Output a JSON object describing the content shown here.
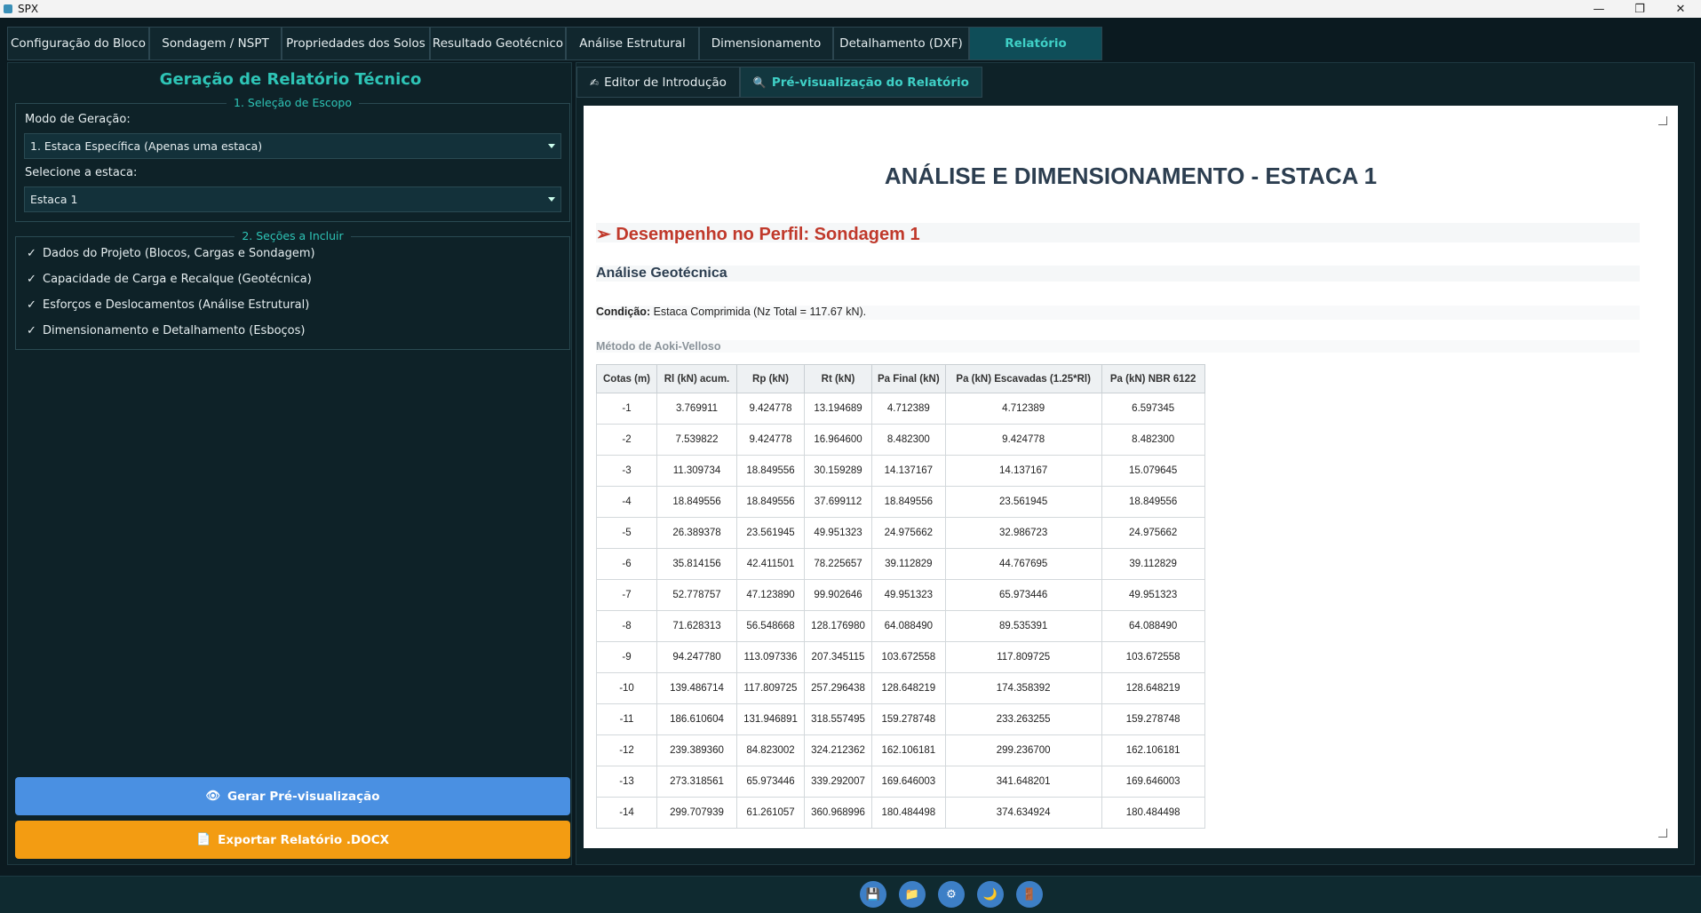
{
  "window": {
    "title": "SPX",
    "min": "—",
    "max": "❐",
    "close": "✕"
  },
  "tabs": [
    {
      "label": "Configuração do Bloco"
    },
    {
      "label": "Sondagem / NSPT"
    },
    {
      "label": "Propriedades dos Solos"
    },
    {
      "label": "Resultado Geotécnico"
    },
    {
      "label": "Análise Estrutural"
    },
    {
      "label": "Dimensionamento"
    },
    {
      "label": "Detalhamento (DXF)"
    },
    {
      "label": "Relatório"
    }
  ],
  "left": {
    "title": "Geração de Relatório Técnico",
    "scope": {
      "legend": "1. Seleção de Escopo",
      "mode_label": "Modo de Geração:",
      "mode_value": "1. Estaca Específica (Apenas uma estaca)",
      "pile_label": "Selecione a estaca:",
      "pile_value": "Estaca 1"
    },
    "sections": {
      "legend": "2. Seções a Incluir",
      "items": [
        {
          "mark": "✓",
          "label": "Dados do Projeto (Blocos, Cargas e Sondagem)"
        },
        {
          "mark": "✓",
          "label": "Capacidade de Carga e Recalque (Geotécnica)"
        },
        {
          "mark": "✓",
          "label": "Esforços e Deslocamentos (Análise Estrutural)"
        },
        {
          "mark": "✓",
          "label": "Dimensionamento e Detalhamento (Esboços)"
        }
      ]
    },
    "preview_button": "Gerar Pré-visualização",
    "export_button": "Exportar Relatório .DOCX",
    "colors": {
      "preview_button": "#4a90e2",
      "export_button": "#f39c12"
    }
  },
  "right": {
    "subtabs": [
      {
        "icon": "✍",
        "label": "Editor de Introdução"
      },
      {
        "icon": "🔍",
        "label": "Pré-visualização do Relatório"
      }
    ],
    "doc": {
      "h1": "ANÁLISE E DIMENSIONAMENTO - ESTACA 1",
      "h2": "➢ Desempenho no Perfil: Sondagem 1",
      "h3": "Análise Geotécnica",
      "cond_label": "Condição:",
      "cond_text": " Estaca Comprimida (Nz Total = 117.67 kN).",
      "h4": "Método de Aoki-Velloso",
      "table": {
        "headers": [
          "Cotas (m)",
          "Rl (kN) acum.",
          "Rp (kN)",
          "Rt (kN)",
          "Pa Final (kN)",
          "Pa (kN) Escavadas (1.25*Rl)",
          "Pa (kN) NBR 6122"
        ],
        "rows": [
          [
            "-1",
            "3.769911",
            "9.424778",
            "13.194689",
            "4.712389",
            "4.712389",
            "6.597345"
          ],
          [
            "-2",
            "7.539822",
            "9.424778",
            "16.964600",
            "8.482300",
            "9.424778",
            "8.482300"
          ],
          [
            "-3",
            "11.309734",
            "18.849556",
            "30.159289",
            "14.137167",
            "14.137167",
            "15.079645"
          ],
          [
            "-4",
            "18.849556",
            "18.849556",
            "37.699112",
            "18.849556",
            "23.561945",
            "18.849556"
          ],
          [
            "-5",
            "26.389378",
            "23.561945",
            "49.951323",
            "24.975662",
            "32.986723",
            "24.975662"
          ],
          [
            "-6",
            "35.814156",
            "42.411501",
            "78.225657",
            "39.112829",
            "44.767695",
            "39.112829"
          ],
          [
            "-7",
            "52.778757",
            "47.123890",
            "99.902646",
            "49.951323",
            "65.973446",
            "49.951323"
          ],
          [
            "-8",
            "71.628313",
            "56.548668",
            "128.176980",
            "64.088490",
            "89.535391",
            "64.088490"
          ],
          [
            "-9",
            "94.247780",
            "113.097336",
            "207.345115",
            "103.672558",
            "117.809725",
            "103.672558"
          ],
          [
            "-10",
            "139.486714",
            "117.809725",
            "257.296438",
            "128.648219",
            "174.358392",
            "128.648219"
          ],
          [
            "-11",
            "186.610604",
            "131.946891",
            "318.557495",
            "159.278748",
            "233.263255",
            "159.278748"
          ],
          [
            "-12",
            "239.389360",
            "84.823002",
            "324.212362",
            "162.106181",
            "299.236700",
            "162.106181"
          ],
          [
            "-13",
            "273.318561",
            "65.973446",
            "339.292007",
            "169.646003",
            "341.648201",
            "169.646003"
          ],
          [
            "-14",
            "299.707939",
            "61.261057",
            "360.968996",
            "180.484498",
            "374.634924",
            "180.484498"
          ]
        ]
      }
    }
  },
  "bottom_buttons": [
    {
      "name": "save-icon",
      "glyph": "💾"
    },
    {
      "name": "folder-icon",
      "glyph": "📁"
    },
    {
      "name": "gear-icon",
      "glyph": "⚙"
    },
    {
      "name": "moon-icon",
      "glyph": "🌙"
    },
    {
      "name": "exit-icon",
      "glyph": "🚪"
    }
  ]
}
